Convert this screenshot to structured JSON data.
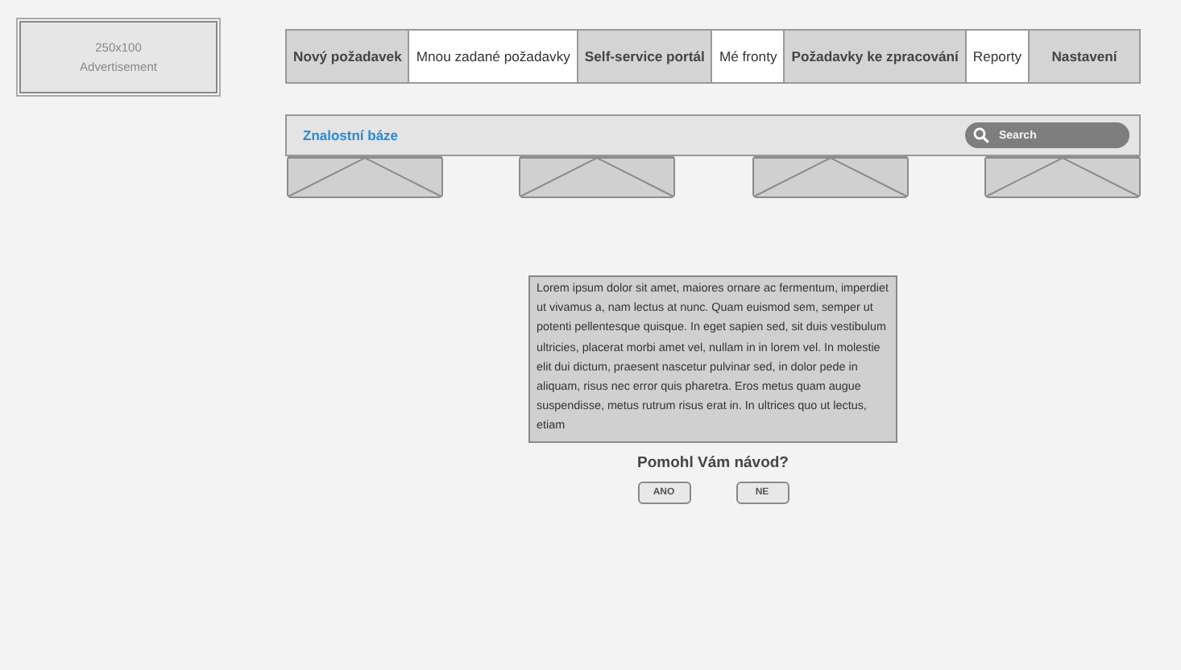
{
  "advertisement": {
    "size": "250x100",
    "label": "Advertisement"
  },
  "tabs": [
    {
      "label": "Nový požadavek",
      "selected": false
    },
    {
      "label": "Mnou zadané požadavky",
      "selected": true
    },
    {
      "label": "Self-service portál",
      "selected": false
    },
    {
      "label": "Mé fronty",
      "selected": true
    },
    {
      "label": "Požadavky ke zpracování",
      "selected": false
    },
    {
      "label": "Reporty",
      "selected": true
    },
    {
      "label": "Nastavení",
      "selected": false
    }
  ],
  "knowledge_base": {
    "title": "Znalostní báze",
    "search": {
      "placeholder": "Search"
    }
  },
  "article": {
    "text": "Lorem ipsum dolor sit amet, maiores ornare ac fermentum, imperdiet ut vivamus a, nam lectus at nunc. Quam euismod sem, semper ut potenti pellentesque quisque. In eget sapien sed, sit duis vestibulum ultricies, placerat morbi amet vel, nullam in in lorem vel. In molestie elit dui dictum, praesent nascetur pulvinar sed, in dolor pede in aliquam, risus nec error quis pharetra. Eros metus quam augue suspendisse, metus rutrum risus erat in.  In ultrices quo ut lectus, etiam"
  },
  "feedback": {
    "question": "Pomohl Vám návod?",
    "buttons": [
      "ANO",
      "NE"
    ]
  }
}
